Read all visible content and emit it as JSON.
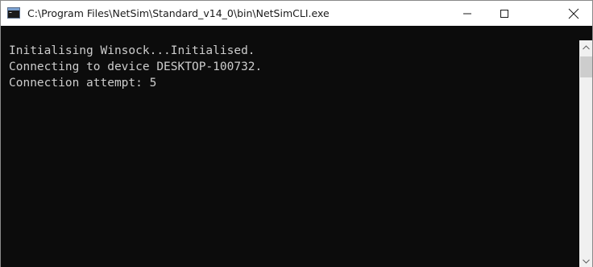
{
  "window": {
    "title": "C:\\Program Files\\NetSim\\Standard_v14_0\\bin\\NetSimCLI.exe",
    "icon": "console-app-icon",
    "controls": {
      "minimize": "minimize-icon",
      "maximize": "maximize-icon",
      "close": "close-icon"
    }
  },
  "console": {
    "lines": [
      "Initialising Winsock...Initialised.",
      "Connecting to device DESKTOP-100732.",
      "Connection attempt: 5"
    ],
    "background": "#0c0c0c",
    "text_color": "#cccccc"
  },
  "scrollbar": {
    "up": "chevron-up-icon",
    "down": "chevron-down-icon"
  }
}
